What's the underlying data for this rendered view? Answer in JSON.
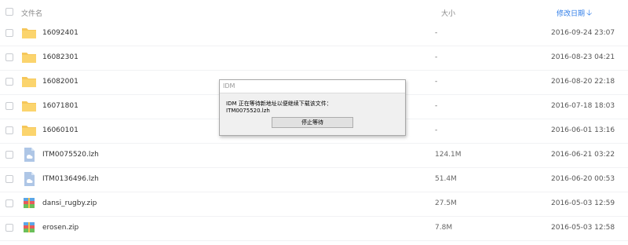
{
  "header": {
    "name_label": "文件名",
    "size_label": "大小",
    "date_label": "修改日期",
    "sort_icon": "arrow-down-icon",
    "accent_color": "#2e7ce8"
  },
  "files": [
    {
      "name": "16092401",
      "size": "-",
      "date": "2016-09-24 23:07",
      "type": "folder"
    },
    {
      "name": "16082301",
      "size": "-",
      "date": "2016-08-23 04:21",
      "type": "folder"
    },
    {
      "name": "16082001",
      "size": "-",
      "date": "2016-08-20 22:18",
      "type": "folder"
    },
    {
      "name": "16071801",
      "size": "-",
      "date": "2016-07-18 18:03",
      "type": "folder"
    },
    {
      "name": "16060101",
      "size": "-",
      "date": "2016-06-01 13:16",
      "type": "folder"
    },
    {
      "name": "ITM0075520.lzh",
      "size": "124.1M",
      "date": "2016-06-21 03:22",
      "type": "file"
    },
    {
      "name": "ITM0136496.lzh",
      "size": "51.4M",
      "date": "2016-06-20 00:53",
      "type": "file"
    },
    {
      "name": "dansi_rugby.zip",
      "size": "27.5M",
      "date": "2016-05-03 12:59",
      "type": "zip"
    },
    {
      "name": "erosen.zip",
      "size": "7.8M",
      "date": "2016-05-03 12:58",
      "type": "zip"
    }
  ],
  "dialog": {
    "title": "IDM",
    "message": "IDM 正在等待新地址以便继续下载该文件：",
    "filename": "ITM0075520.lzh",
    "button_label": "停止等待"
  }
}
